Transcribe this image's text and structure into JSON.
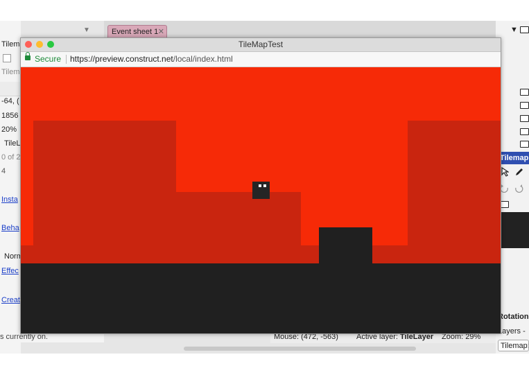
{
  "editor": {
    "tab_label": "Event sheet 1",
    "tab_close": "✕",
    "left_panel": {
      "texts": [
        "Tilem",
        "Tilem",
        "-64, (",
        "1856",
        "20%",
        "TileL",
        "0 of 2",
        "4"
      ],
      "links": [
        "Insta",
        "Beha",
        "Effec",
        "Creat"
      ],
      "norm": "Norm",
      "footer": "s currently on."
    },
    "right_panel": {
      "header": "Tilemap:",
      "rotation": "Rotation",
      "layers": "Layers -",
      "tilemap_tab": "Tilemap:",
      "arrow": "▼"
    },
    "status_bar": {
      "mouse": "Mouse: (472, -563)",
      "active_layer_label": "Active layer:",
      "active_layer_value": "TileLayer",
      "zoom": "Zoom: 29%"
    }
  },
  "browser": {
    "title": "TileMapTest",
    "secure_label": "Secure",
    "url_host": "https://preview.construct.net",
    "url_path": "/local/index.html"
  },
  "colors": {
    "sky": "#f62a07",
    "terrain": "#c9250f",
    "ground": "#202020",
    "player": "#252525",
    "close_dot": "#fe5f57",
    "min_dot": "#febc2e",
    "max_dot": "#28c840"
  }
}
